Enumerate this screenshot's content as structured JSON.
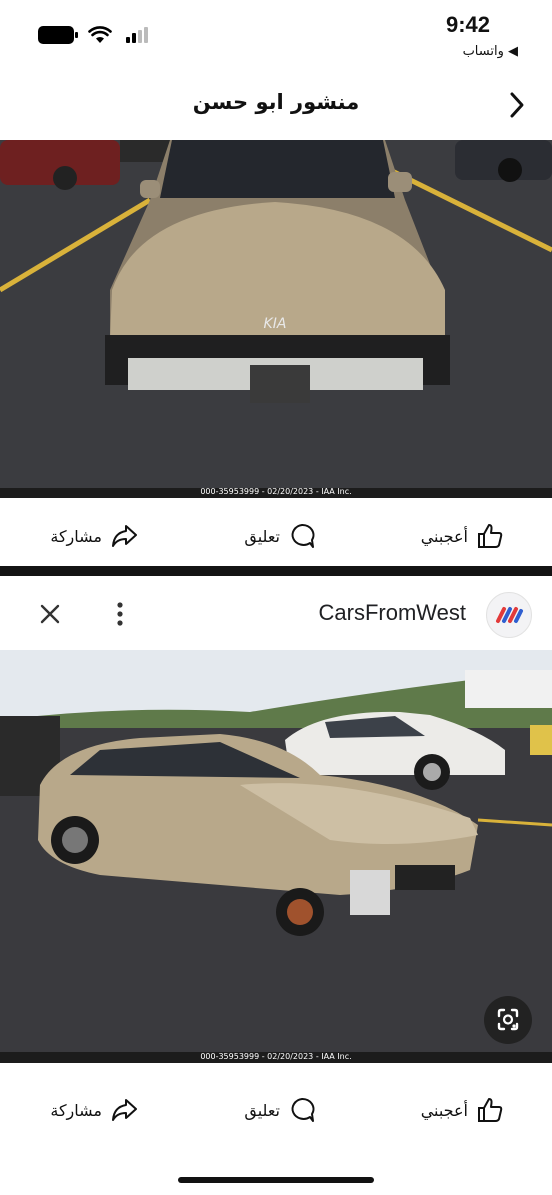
{
  "status_bar": {
    "time": "9:42",
    "back_app": "◀ واتساب"
  },
  "header": {
    "title": "منشور ابو حسن"
  },
  "post_image": {
    "caption": "000-35953999 - 02/20/2023 - IAA Inc."
  },
  "post_actions": {
    "like_label": "أعجبني",
    "comment_label": "تعليق",
    "share_label": "مشاركة"
  },
  "card": {
    "source_name": "CarsFromWest",
    "image_caption": "000-35953999 - 02/20/2023 - IAA Inc."
  },
  "card_actions": {
    "like_label": "أعجبني",
    "comment_label": "تعليق",
    "share_label": "مشاركة"
  },
  "colors": {
    "car_gold": "#b8a88a",
    "asphalt": "#3a3a3e",
    "sky": "#e4e9ee",
    "divider": "#141414"
  }
}
